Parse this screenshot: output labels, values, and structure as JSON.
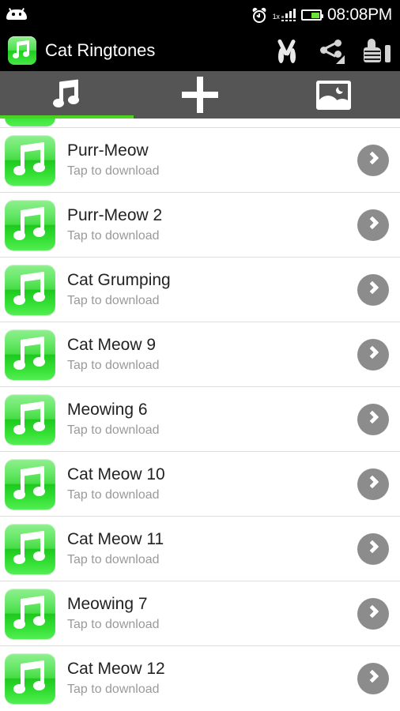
{
  "status_bar": {
    "notification_icon": "android-robot-icon",
    "alarm_icon": "alarm-clock-icon",
    "signal_label": "1x",
    "battery_icon": "battery-icon",
    "time": "08:08PM",
    "accent_green": "#6ee038"
  },
  "action_bar": {
    "app_icon": "app-music-note-icon",
    "title": "Cat Ringtones",
    "actions": [
      {
        "name": "cut-scissors-icon"
      },
      {
        "name": "share-icon"
      },
      {
        "name": "thumbs-up-icon"
      }
    ]
  },
  "tabs": {
    "active_index": 0,
    "indicator_color": "#4cd321",
    "bar_color": "#555555",
    "items": [
      {
        "icon": "music-note-icon",
        "name": "tab-ringtones"
      },
      {
        "icon": "plus-icon",
        "name": "tab-add"
      },
      {
        "icon": "image-icon",
        "name": "tab-wallpapers"
      }
    ]
  },
  "list": {
    "subtitle_default": "Tap to download",
    "icon_color_top": "#8fef8f",
    "icon_color_bottom": "#1ec91e",
    "chevron_color": "#8c8c8c",
    "items": [
      {
        "title": "Purr-Meow",
        "subtitle": "Tap to download"
      },
      {
        "title": "Purr-Meow 2",
        "subtitle": "Tap to download"
      },
      {
        "title": "Cat Grumping",
        "subtitle": "Tap to download"
      },
      {
        "title": "Cat Meow 9",
        "subtitle": "Tap to download"
      },
      {
        "title": "Meowing 6",
        "subtitle": "Tap to download"
      },
      {
        "title": "Cat Meow 10",
        "subtitle": "Tap to download"
      },
      {
        "title": "Cat Meow 11",
        "subtitle": "Tap to download"
      },
      {
        "title": "Meowing 7",
        "subtitle": "Tap to download"
      },
      {
        "title": "Cat Meow 12",
        "subtitle": "Tap to download"
      }
    ]
  }
}
